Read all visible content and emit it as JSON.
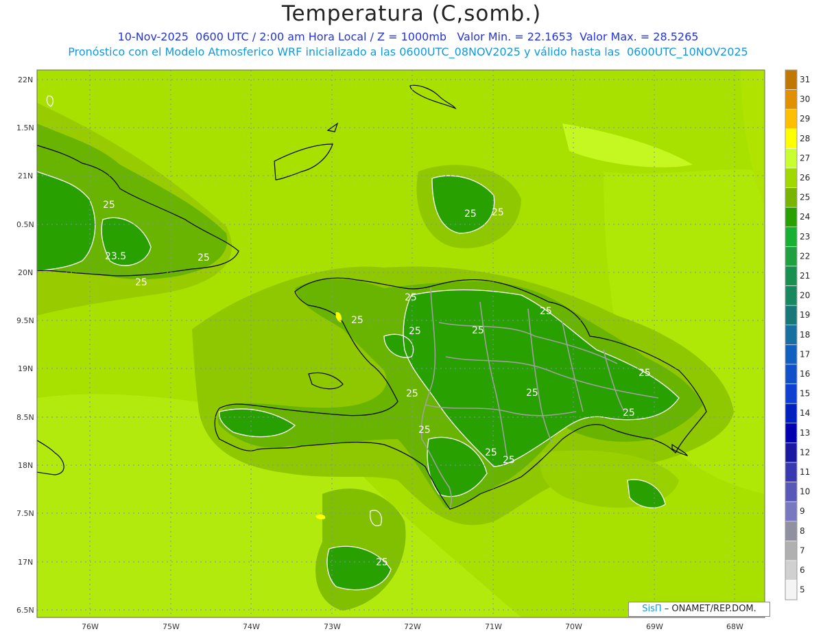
{
  "header": {
    "title": "Temperatura (C,somb.)",
    "subtitle1": "10-Nov-2025  0600 UTC / 2:00 am Hora Local / Z = 1000mb   Valor Min. = 22.1653  Valor Max. = 28.5265",
    "subtitle2": "Pronóstico con el Modelo Atmosferico WRF inicializado a las 0600UTC_08NOV2025 y válido hasta las  0600UTC_10NOV2025"
  },
  "axes": {
    "lat_labels": [
      "22N",
      "1.5N",
      "21N",
      "0.5N",
      "20N",
      "9.5N",
      "19N",
      "8.5N",
      "18N",
      "7.5N",
      "17N",
      "6.5N"
    ],
    "lon_labels": [
      "76W",
      "75W",
      "74W",
      "73W",
      "72W",
      "71W",
      "70W",
      "69W",
      "68W"
    ]
  },
  "colorbar": {
    "levels": [
      "31",
      "30",
      "29",
      "28",
      "27",
      "26",
      "25",
      "24",
      "23",
      "22",
      "21",
      "20",
      "19",
      "18",
      "17",
      "16",
      "15",
      "14",
      "13",
      "12",
      "11",
      "10",
      "9",
      "8",
      "7",
      "6",
      "5"
    ],
    "colors": [
      "#c07800",
      "#e09000",
      "#ffbf00",
      "#ffff00",
      "#c8ff30",
      "#a0d800",
      "#78b400",
      "#28a000",
      "#18b030",
      "#20a040",
      "#189050",
      "#188860",
      "#187878",
      "#1870a0",
      "#1060c0",
      "#1050c8",
      "#1040d0",
      "#0020c0",
      "#0000b0",
      "#1818a0",
      "#3838b0",
      "#5858b8",
      "#7878c0",
      "#9090a0",
      "#b0b0b0",
      "#d0d0d0",
      "#f4f4f4"
    ]
  },
  "contour_labels": [
    "25",
    "25",
    "25",
    "23.5",
    "25",
    "25",
    "25",
    "25",
    "25",
    "25",
    "25",
    "25",
    "25",
    "25",
    "25",
    "25",
    "25",
    "25",
    "25",
    "25",
    "25"
  ],
  "credit": {
    "brand": "SisΠ",
    "text": " – ONAMET/REP.DOM."
  },
  "colors": {
    "land_fill": "#28a000",
    "sea_light": "#c8ff30",
    "sea_mid": "#a0d800",
    "sea_warm": "#a8e000",
    "contour": "#ffffff",
    "coast": "#000000",
    "border": "#a0a0a0",
    "grid": "#8888cc"
  }
}
